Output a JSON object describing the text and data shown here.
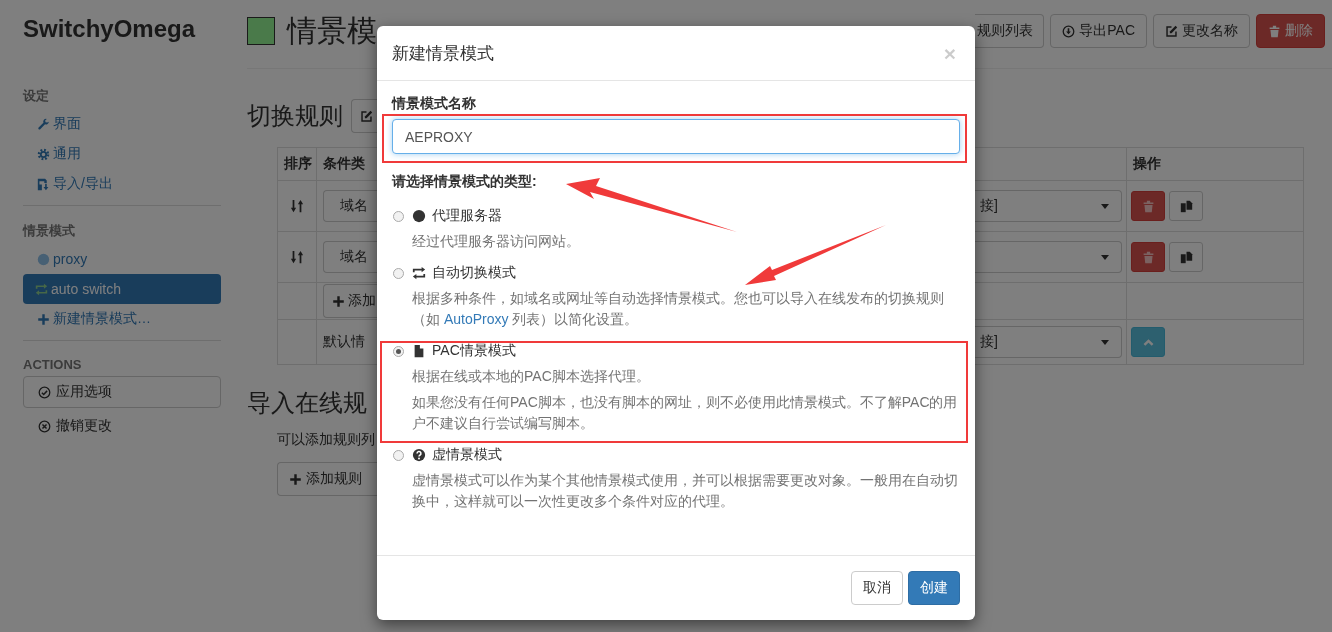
{
  "sidebar": {
    "brand": "SwitchyOmega",
    "sections": [
      {
        "heading": "设定",
        "items": [
          {
            "label": "界面",
            "selected": false
          },
          {
            "label": "通用",
            "selected": false
          },
          {
            "label": "导入/导出",
            "selected": false
          }
        ]
      },
      {
        "heading": "情景模式",
        "items": [
          {
            "label": "proxy",
            "selected": false
          },
          {
            "label": "auto switch",
            "selected": true
          },
          {
            "label": "新建情景模式…",
            "selected": false
          }
        ]
      }
    ],
    "actions_heading": "ACTIONS",
    "actions": [
      {
        "kind": "outlined",
        "label": "应用选项"
      },
      {
        "kind": "plain",
        "label": "撤销更改"
      }
    ]
  },
  "header": {
    "color": "#4a7a4a",
    "title": "情景模",
    "buttons": [
      {
        "kind": "partial",
        "label": "规则列表"
      },
      {
        "kind": "default",
        "label": "导出PAC"
      },
      {
        "kind": "default",
        "label": "更改名称"
      },
      {
        "kind": "danger",
        "label": "删除"
      }
    ]
  },
  "rules": {
    "heading": "切换规则",
    "columns": [
      "排序",
      "条件类",
      "操作"
    ],
    "rows": [
      {
        "kind": "rule",
        "condition_type": "域名",
        "profile": "接]"
      },
      {
        "kind": "rule",
        "condition_type": "域名",
        "profile": ""
      },
      {
        "kind": "add",
        "add_label": "添加"
      },
      {
        "kind": "default",
        "label": "默认情",
        "profile": "接]"
      }
    ]
  },
  "import": {
    "heading": "导入在线规",
    "text": "可以添加规则列",
    "button": "添加规则"
  },
  "dialog": {
    "title": "新建情景模式",
    "close": "×",
    "name_label": "情景模式名称",
    "name_value": "AEPROXY",
    "type_label": "请选择情景模式的类型:",
    "options": [
      {
        "title": "代理服务器",
        "selected": false,
        "paragraphs": [
          {
            "text": "经过代理服务器访问网站。"
          }
        ]
      },
      {
        "title": "自动切换模式",
        "selected": false,
        "paragraphs": [
          {
            "before": "根据多种条件，如域名或网址等自动选择情景模式。您也可以导入在线发布的切换规则（如 ",
            "link": "AutoProxy",
            "after": " 列表）以简化设置。"
          }
        ]
      },
      {
        "title": "PAC情景模式",
        "selected": true,
        "paragraphs": [
          {
            "text": "根据在线或本地的PAC脚本选择代理。"
          },
          {
            "text": "如果您没有任何PAC脚本，也没有脚本的网址，则不必使用此情景模式。不了解PAC的用户不建议自行尝试编写脚本。"
          }
        ]
      },
      {
        "title": "虚情景模式",
        "selected": false,
        "paragraphs": [
          {
            "text": "虚情景模式可以作为某个其他情景模式使用，并可以根据需要更改对象。一般用在自动切换中，这样就可以一次性更改多个条件对应的代理。"
          }
        ]
      }
    ],
    "buttons": [
      {
        "kind": "default",
        "label": "取消"
      },
      {
        "kind": "primary",
        "label": "创建"
      }
    ]
  }
}
